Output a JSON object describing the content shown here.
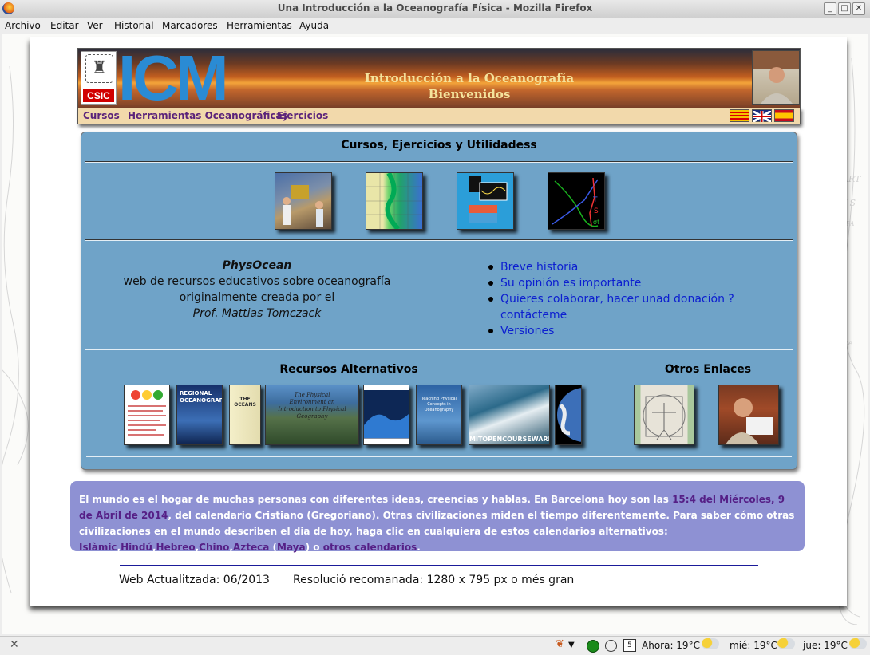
{
  "window": {
    "title": "Una Introducción a la Oceanografía Física - Mozilla Firefox"
  },
  "menu": [
    "Archivo",
    "Editar",
    "Ver",
    "Historial",
    "Marcadores",
    "Herramientas",
    "Ayuda"
  ],
  "header": {
    "logo_text": "CSIC",
    "brand": "ICM",
    "title_line1": "Introducción a la Oceanografía",
    "title_line2": "Bienvenidos"
  },
  "nav": {
    "items": [
      "Cursos",
      "Herramientas Oceanográficas",
      "Ejercicios"
    ]
  },
  "panel": {
    "heading": "Cursos, Ejercicios y Utilidadess",
    "physocean": {
      "name": "PhysOcean",
      "line1": "web de recursos educativos sobre oceanografía",
      "line2": "originalmente creada por el",
      "author": "Prof. Mattias Tomczack"
    },
    "links": [
      "Breve historia",
      "Su opinión es importante",
      "Quieres colaborar, hacer unad donación ? contácteme",
      "Versiones"
    ],
    "resources_heading": "Recursos Alternativos",
    "others_heading": "Otros Enlaces"
  },
  "thumbnails": {
    "plot_labels": {
      "t": "T",
      "s": "S",
      "sigma": "σt"
    }
  },
  "books": {
    "book2_text": "REGIONAL OCEANOGRAPHY",
    "book3_text": "THE OCEANS",
    "book4_text": "The Physical Environment an Introduction to Physical Geography",
    "book6_text": "Teaching Physical Concepts in Oceanography",
    "mit_text": "MITOPENCOURSEWARE"
  },
  "info": {
    "text1": "El mundo es el hogar de muchas personas con diferentes ideas, creencias y hablas. En Barcelona hoy son las ",
    "date": "15:4 del Miércoles, 9 de Abril de 2014",
    "text2": ", del calendario Cristiano (Gregoriano). Otras civilizaciones miden el tiempo diferentemente. Para saber cómo otras civilizaciones en el mundo describen el dia de hoy, haga clic en cualquiera de estos calendarios alternativos: ",
    "cal_islamic": "Islàmic",
    "cal_hindu": "Hindú",
    "cal_hebrew": "Hebreo",
    "cal_chinese": "Chino",
    "cal_aztec": "Azteca",
    "cal_maya": "Maya",
    "text_o": " o ",
    "cal_others": "otros calendarios"
  },
  "footer": {
    "updated": "Web Actualitzada: 06/2013",
    "resolution": "Resolució recomanada: 1280 x 795 px o més gran"
  },
  "statusbar": {
    "now": "Ahora: 19°C",
    "wed": "mié: 19°C",
    "thu": "jue: 19°C",
    "calendar_day": "5"
  },
  "colors": {
    "panel": "#6fa3c8",
    "nav_link": "#5b237a",
    "link": "#0c1ed0",
    "infobox": "#8e91d3"
  }
}
